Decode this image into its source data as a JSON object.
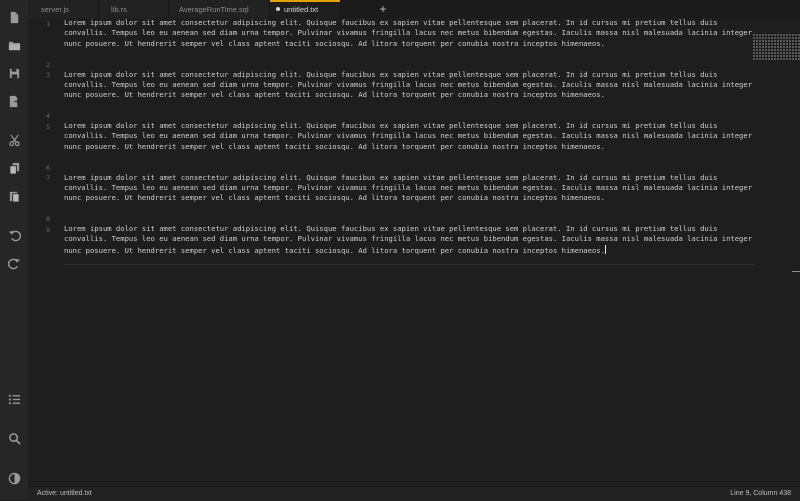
{
  "tabs": [
    {
      "label": "server.js",
      "active": false,
      "modified": false
    },
    {
      "label": "lib.rs",
      "active": false,
      "modified": false
    },
    {
      "label": "AverageRunTime.sql",
      "active": false,
      "modified": false
    },
    {
      "label": "untitled.txt",
      "active": true,
      "modified": true
    }
  ],
  "new_tab_label": "+",
  "sidebar_icons": [
    "new-file-icon",
    "open-folder-icon",
    "save-icon",
    "export-icon",
    "cut-icon",
    "copy-icon",
    "paste-icon",
    "undo-icon",
    "redo-icon",
    "list-icon",
    "search-icon",
    "theme-icon"
  ],
  "editor": {
    "line_numbers": [
      "1",
      "2",
      "3",
      "4",
      "5",
      "6",
      "7",
      "8",
      "9"
    ],
    "paragraphs": [
      "Lorem ipsum dolor sit amet consectetur adipiscing elit. Quisque faucibus ex sapien vitae pellentesque sem placerat. In id cursus mi pretium tellus duis convallis. Tempus leo eu aenean sed diam urna tempor. Pulvinar vivamus fringilla lacus nec metus bibendum egestas. Iaculis massa nisl malesuada lacinia integer nunc posuere. Ut hendrerit semper vel class aptent taciti sociosqu. Ad litora torquent per conubia nostra inceptos himenaeos.",
      "Lorem ipsum dolor sit amet consectetur adipiscing elit. Quisque faucibus ex sapien vitae pellentesque sem placerat. In id cursus mi pretium tellus duis convallis. Tempus leo eu aenean sed diam urna tempor. Pulvinar vivamus fringilla lacus nec metus bibendum egestas. Iaculis massa nisl malesuada lacinia integer nunc posuere. Ut hendrerit semper vel class aptent taciti sociosqu. Ad litora torquent per conubia nostra inceptos himenaeos.",
      "Lorem ipsum dolor sit amet consectetur adipiscing elit. Quisque faucibus ex sapien vitae pellentesque sem placerat. In id cursus mi pretium tellus duis convallis. Tempus leo eu aenean sed diam urna tempor. Pulvinar vivamus fringilla lacus nec metus bibendum egestas. Iaculis massa nisl malesuada lacinia integer nunc posuere. Ut hendrerit semper vel class aptent taciti sociosqu. Ad litora torquent per conubia nostra inceptos himenaeos.",
      "Lorem ipsum dolor sit amet consectetur adipiscing elit. Quisque faucibus ex sapien vitae pellentesque sem placerat. In id cursus mi pretium tellus duis convallis. Tempus leo eu aenean sed diam urna tempor. Pulvinar vivamus fringilla lacus nec metus bibendum egestas. Iaculis massa nisl malesuada lacinia integer nunc posuere. Ut hendrerit semper vel class aptent taciti sociosqu. Ad litora torquent per conubia nostra inceptos himenaeos.",
      "Lorem ipsum dolor sit amet consectetur adipiscing elit. Quisque faucibus ex sapien vitae pellentesque sem placerat. In id cursus mi pretium tellus duis convallis. Tempus leo eu aenean sed diam urna tempor. Pulvinar vivamus fringilla lacus nec metus bibendum egestas. Iaculis massa nisl malesuada lacinia integer nunc posuere. Ut hendrerit semper vel class aptent taciti sociosqu. Ad litora torquent per conubia nostra inceptos himenaeos."
    ]
  },
  "status": {
    "left": "Active: untitled.txt",
    "right": "Line 9, Column 438"
  },
  "colors": {
    "background": "#1e1e1e",
    "sidebar": "#262626",
    "active_tab_accent": "#e0a300",
    "text": "#cfcfcf"
  }
}
